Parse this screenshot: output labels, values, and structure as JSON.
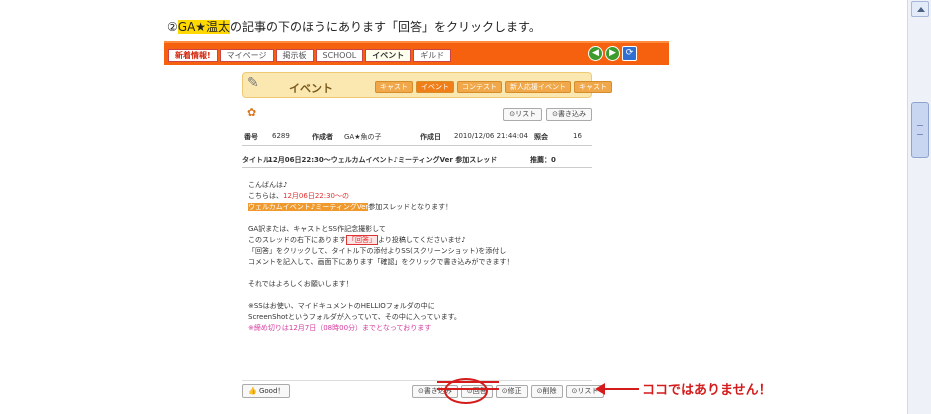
{
  "instruction": {
    "prefix": "②",
    "highlight": "GA★温太",
    "suffix": "の記事の下のほうにあります「回答」をクリックします。"
  },
  "topnav": {
    "tabs": [
      "新着情報!",
      "マイページ",
      "掲示板",
      "SCHOOL",
      "イベント",
      "ギルド"
    ]
  },
  "event": {
    "title": "イベント",
    "subtabs": [
      "キャスト",
      "イベント",
      "コンテスト",
      "新人応援イベント",
      "キャスト"
    ]
  },
  "buttons_top": {
    "list": "リスト",
    "write": "書き込み"
  },
  "meta": {
    "number_label": "番号",
    "number": "6289",
    "author_label": "作成者",
    "author": "GA★魚の子",
    "date_label": "作成日",
    "date": "2010/12/06 21:44:04",
    "views_label": "照会",
    "views": "16"
  },
  "post": {
    "title_label": "タイトル",
    "title": "12月06日22:30〜ウェルカムイベント♪ミーティングVer 参加スレッド",
    "recommend": "推薦：0"
  },
  "body": {
    "line1": "こんばんは♪",
    "line2_pre": "こちらは、",
    "line2_red": "12月06日22:30〜の",
    "line3_hl": "ウェルカムイベント♪ミーティングVer",
    "line3_post": "参加スレッドとなります！",
    "line4": "GA訳または、キャストとSS作記念撮影して",
    "line5_pre": "このスレッドの右下にあります",
    "line5_box": "「回答」",
    "line5_post": "より投稿してくださいませ♪",
    "line6": "「回答」をクリックして、タイトル下の添付よりSS(スクリーンショット)を添付し",
    "line7": "コメントを記入して、画面下にあります「確認」をクリックで書き込みができます！",
    "line8": "それではよろしくお願いします！",
    "line9": "※SSはお使い、マイドキュメントのHELLIOフォルダの中に",
    "line10": "ScreenShotというフォルダが入っていて、その中に入っています。",
    "line11": "※締め切りは12月7日（08時00分）までとなっております"
  },
  "buttons_bottom": {
    "good": "Good！",
    "write": "書き込み",
    "answer": "回答",
    "edit": "修正",
    "delete": "削除",
    "list": "リスト"
  },
  "annotation": {
    "note": "ココではありません！"
  }
}
